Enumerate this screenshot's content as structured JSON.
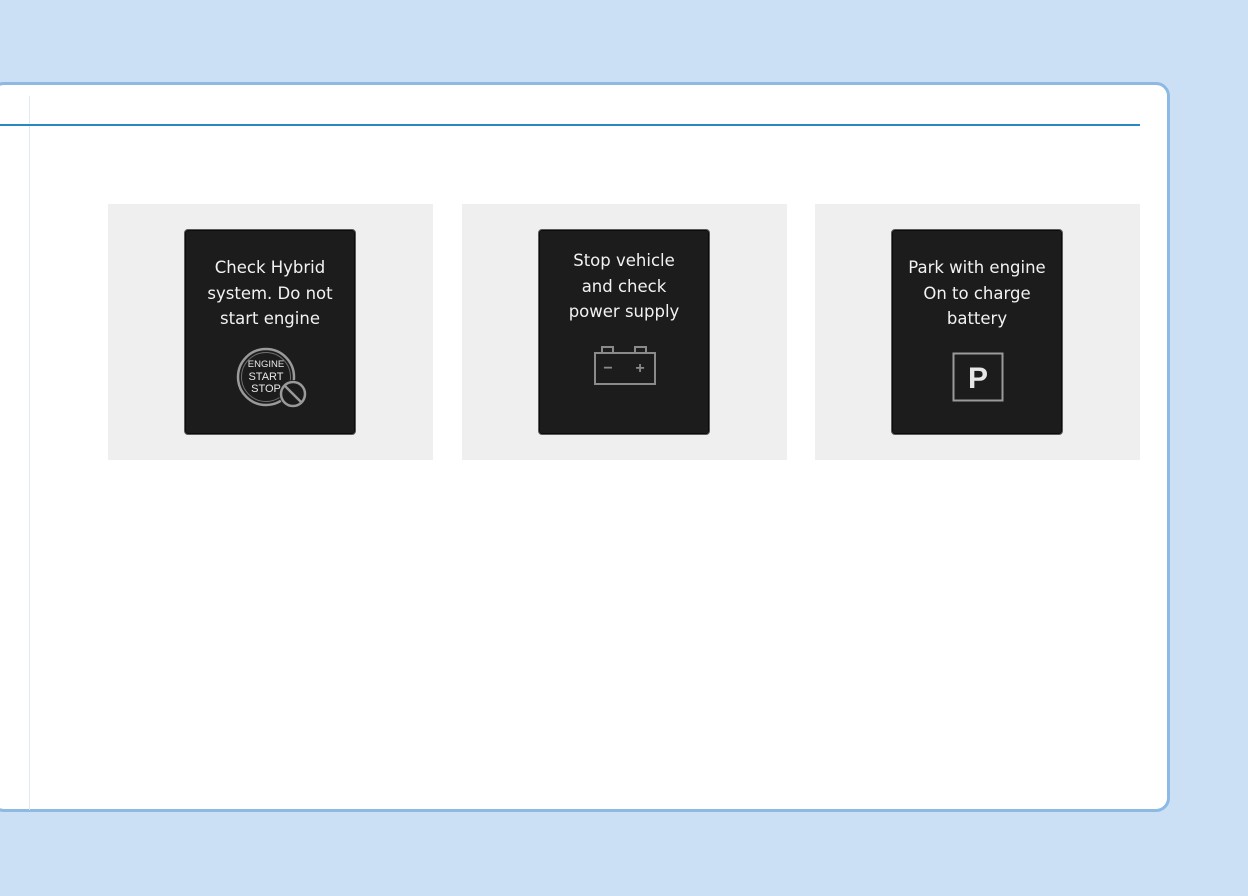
{
  "panels": [
    {
      "message": "Check Hybrid\nsystem. Do not\nstart engine",
      "icon": "engine-start-stop-prohibited-icon",
      "icon_text": {
        "line1": "ENGINE",
        "line2": "START",
        "line3": "STOP"
      }
    },
    {
      "message": "Stop vehicle\nand check\npower supply",
      "icon": "battery-icon",
      "icon_text": {
        "minus": "−",
        "plus": "+"
      }
    },
    {
      "message": "Park with engine\nOn to charge\nbattery",
      "icon": "park-icon",
      "icon_text": {
        "letter": "P"
      }
    }
  ],
  "colors": {
    "background": "#cce0f5",
    "card_border": "#8db9e2",
    "header_rule": "#2b87c4",
    "panel_bg": "#efefef",
    "screen_bg": "#1c1c1c",
    "screen_text": "#f2f2f2",
    "icon_gray": "#8a8a8a"
  }
}
